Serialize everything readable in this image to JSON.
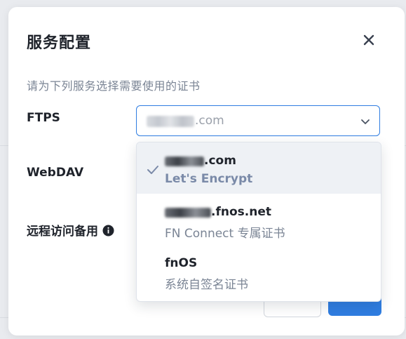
{
  "dialog": {
    "title": "服务配置",
    "subtitle": "请为下列服务选择需要使用的证书"
  },
  "rows": {
    "ftps_label": "FTPS",
    "webdav_label": "WebDAV",
    "remote_label": "远程访问备用"
  },
  "select": {
    "value": ".com"
  },
  "options": [
    {
      "domain": ".com",
      "issuer": "Let's Encrypt",
      "selected": true
    },
    {
      "domain": ".fnos.net",
      "issuer": "FN Connect 专属证书",
      "selected": false
    },
    {
      "domain": "fnOS",
      "issuer": "系统自签名证书",
      "selected": false
    }
  ],
  "colors": {
    "accent": "#2f7de1",
    "text_primary": "#1f232b",
    "text_secondary": "#7b8595"
  },
  "icons": {
    "close": "close-icon",
    "chevron": "chevron-down-icon",
    "check": "check-icon",
    "info": "info-icon"
  }
}
